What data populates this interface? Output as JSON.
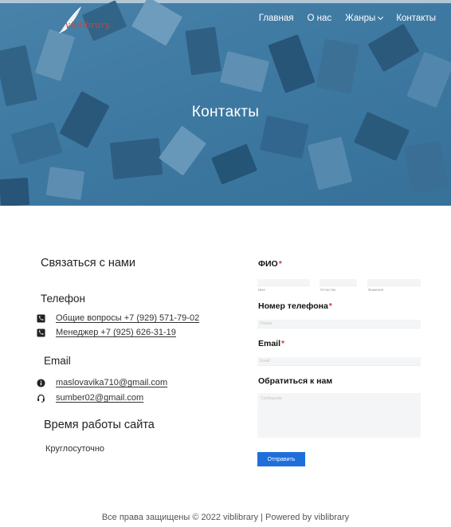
{
  "header": {
    "logo_text": "viblibrary",
    "nav": {
      "home": "Главная",
      "about": "О нас",
      "genres": "Жанры",
      "contacts": "Контакты"
    }
  },
  "hero": {
    "title": "Контакты"
  },
  "contacts": {
    "section_title": "Связаться с нами",
    "phone_title": "Телефон",
    "phone_general": "Общие вопросы +7 (929) 571-79-02",
    "phone_manager": "Менеджер +7 (925) 626-31-19",
    "email_title": "Email",
    "email_primary": "maslovavika710@gmail.com",
    "email_secondary": "sumber02@gmail.com",
    "hours_title": "Время работы сайта",
    "hours_value": "Круглосуточно"
  },
  "form": {
    "fio_label": "ФИО",
    "fio_first_sub": "Имя",
    "fio_middle_sub": "Отчество",
    "fio_last_sub": "Фамилия",
    "phone_label": "Номер телефона",
    "phone_placeholder": "Номер",
    "email_label": "Email",
    "email_placeholder": "Email",
    "message_label": "Обратиться к нам",
    "message_placeholder": "Сообщение",
    "submit_label": "Отправить",
    "required_mark": "*"
  },
  "footer": {
    "text": "Все права защищены © 2022 viblibrary | Powered by viblibrary"
  },
  "colors": {
    "hero_blue": "#4379a2",
    "required_red": "#d93636",
    "button_blue": "#1f6fdb"
  },
  "icons": {
    "phone": "phone-icon",
    "phone2": "phone-icon",
    "email": "info-icon",
    "email2": "headset-icon"
  }
}
